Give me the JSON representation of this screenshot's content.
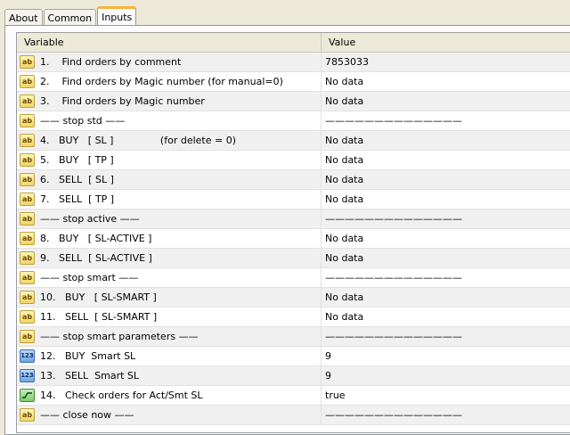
{
  "tabs": [
    "About",
    "Common",
    "Inputs"
  ],
  "table": {
    "headers": {
      "variable": "Variable",
      "value": "Value"
    },
    "rows": [
      {
        "icon": "ab",
        "label": "1.    Find orders by comment",
        "value": "7853033"
      },
      {
        "icon": "ab",
        "label": "2.    Find orders by Magic number (for manual=0)",
        "value": "No data"
      },
      {
        "icon": "ab",
        "label": "3.    Find orders by Magic number",
        "value": "No data"
      },
      {
        "icon": "ab",
        "label": "—— stop std ——",
        "value": "——————————————"
      },
      {
        "icon": "ab",
        "label": "4.   BUY   [ SL ]               (for delete = 0)",
        "value": "No data"
      },
      {
        "icon": "ab",
        "label": "5.   BUY   [ TP ]",
        "value": "No data"
      },
      {
        "icon": "ab",
        "label": "6.   SELL  [ SL ]",
        "value": "No data"
      },
      {
        "icon": "ab",
        "label": "7.   SELL  [ TP ]",
        "value": "No data"
      },
      {
        "icon": "ab",
        "label": "—— stop active ——",
        "value": "——————————————"
      },
      {
        "icon": "ab",
        "label": "8.   BUY   [ SL-ACTIVE ]",
        "value": "No data"
      },
      {
        "icon": "ab",
        "label": "9.   SELL  [ SL-ACTIVE ]",
        "value": "No data"
      },
      {
        "icon": "ab",
        "label": "—— stop smart ——",
        "value": "——————————————"
      },
      {
        "icon": "ab",
        "label": "10.   BUY   [ SL-SMART ]",
        "value": "No data"
      },
      {
        "icon": "ab",
        "label": "11.   SELL  [ SL-SMART ]",
        "value": "No data"
      },
      {
        "icon": "ab",
        "label": "—— stop smart parameters ——",
        "value": "——————————————"
      },
      {
        "icon": "123",
        "label": "12.   BUY  Smart SL",
        "value": "9"
      },
      {
        "icon": "123",
        "label": "13.   SELL  Smart SL",
        "value": "9"
      },
      {
        "icon": "bool",
        "label": "14.   Check orders for Act/Smt SL",
        "value": "true"
      },
      {
        "icon": "ab",
        "label": "—— close now ——",
        "value": "——————————————"
      }
    ]
  }
}
